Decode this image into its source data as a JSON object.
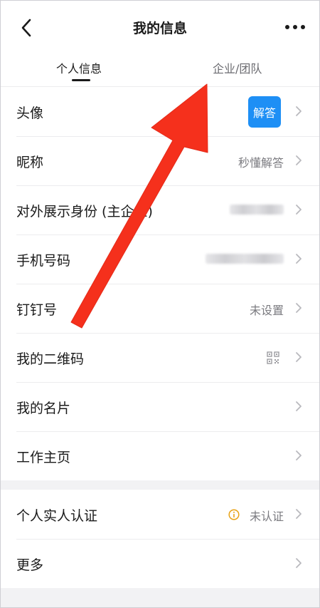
{
  "header": {
    "title": "我的信息",
    "back_icon": "chevron-left-icon",
    "more_icon": "more-dots-icon"
  },
  "tabs": [
    {
      "label": "个人信息",
      "active": true
    },
    {
      "label": "企业/团队",
      "active": false
    }
  ],
  "profile_rows": [
    {
      "label": "头像",
      "avatar_text": "解答"
    },
    {
      "label": "昵称",
      "value": "秒懂解答"
    },
    {
      "label": "对外展示身份 (主企业)"
    },
    {
      "label": "手机号码"
    },
    {
      "label": "钉钉号",
      "value": "未设置"
    },
    {
      "label": "我的二维码"
    },
    {
      "label": "我的名片"
    },
    {
      "label": "工作主页"
    }
  ],
  "secondary_rows": [
    {
      "label": "个人实人认证",
      "value": "未认证"
    },
    {
      "label": "更多"
    }
  ],
  "colors": {
    "avatar_bg": "#1e8ff5",
    "annotation_arrow": "#f5301c",
    "warning": "#e8a317"
  }
}
